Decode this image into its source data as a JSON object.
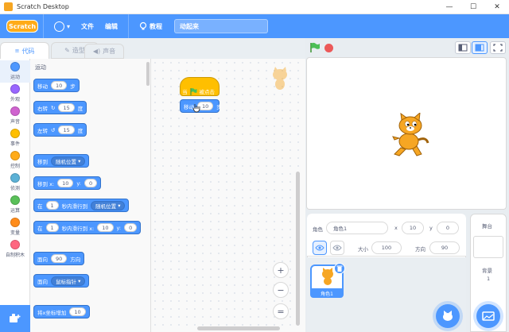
{
  "window": {
    "title": "Scratch Desktop",
    "controls": [
      "—",
      "☐",
      "✕"
    ]
  },
  "menubar": {
    "logo": "Scratch",
    "file": "文件",
    "edit": "编辑",
    "tutorials": "教程",
    "project_name": "动起来"
  },
  "tabs": {
    "code": "代码",
    "costumes": "造型",
    "sounds": "声音"
  },
  "categories": [
    {
      "label": "运动",
      "color": "#4c97ff"
    },
    {
      "label": "外观",
      "color": "#9966ff"
    },
    {
      "label": "声音",
      "color": "#cf63cf"
    },
    {
      "label": "事件",
      "color": "#ffbf00"
    },
    {
      "label": "控制",
      "color": "#ffab19"
    },
    {
      "label": "侦测",
      "color": "#5cb1d6"
    },
    {
      "label": "运算",
      "color": "#59c059"
    },
    {
      "label": "变量",
      "color": "#ff8c1a"
    },
    {
      "label": "自制积木",
      "color": "#ff6680"
    }
  ],
  "palette": {
    "section_title": "运动",
    "move": {
      "prefix": "移动",
      "value": "10",
      "suffix": "步"
    },
    "turn_right": {
      "prefix": "右转",
      "value": "15",
      "suffix": "度"
    },
    "turn_left": {
      "prefix": "左转",
      "value": "15",
      "suffix": "度"
    },
    "goto": {
      "prefix": "移到",
      "option": "随机位置"
    },
    "goto_xy": {
      "prefix": "移到 x:",
      "x": "10",
      "ylabel": "y:",
      "y": "0"
    },
    "glide": {
      "prefix": "在",
      "secs": "1",
      "mid": "秒内滑行到",
      "option": "随机位置"
    },
    "glide_xy": {
      "prefix": "在",
      "secs": "1",
      "mid": "秒内滑行到 x:",
      "x": "10",
      "ylabel": "y:",
      "y": "0"
    },
    "point_dir": {
      "prefix": "面向",
      "value": "90",
      "suffix": "方向"
    },
    "point_towards": {
      "prefix": "面向",
      "option": "鼠标指针"
    },
    "change_x": {
      "prefix": "将x坐标增加",
      "value": "10"
    }
  },
  "workspace": {
    "hat_when": "当",
    "hat_clicked": "被点击",
    "move_prefix": "移动",
    "move_value": "10",
    "move_suffix": "步"
  },
  "zoom": {
    "in": "+",
    "out": "−",
    "reset": "="
  },
  "sprite_info": {
    "sprite_label": "角色",
    "sprite_name": "角色1",
    "x_label": "x",
    "x": "10",
    "y_label": "y",
    "y": "0",
    "show_label": "显示",
    "size_label": "大小",
    "size": "100",
    "direction_label": "方向",
    "direction": "90"
  },
  "sprite_list": [
    {
      "name": "角色1"
    }
  ],
  "stage_panel": {
    "title": "舞台",
    "backdrops_label": "背景",
    "backdrops_count": "1"
  },
  "colors": {
    "accent": "#4c97ff",
    "motion": "#4c97ff",
    "events": "#ffbf00"
  }
}
